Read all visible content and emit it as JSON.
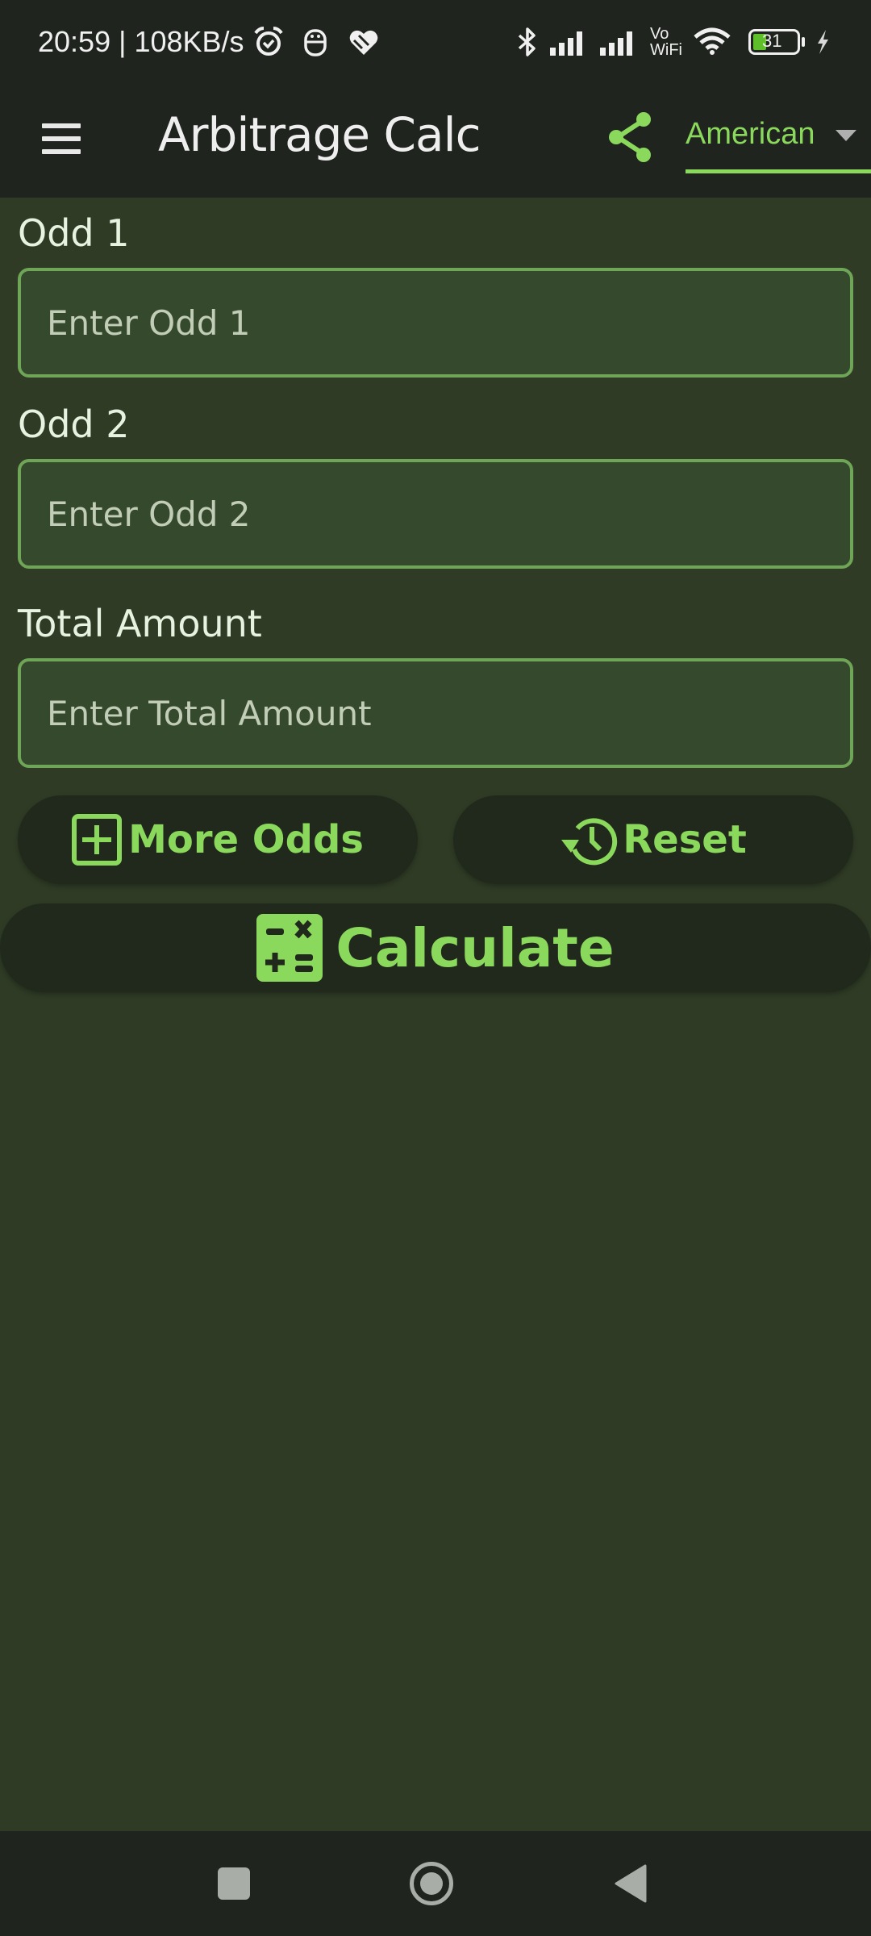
{
  "status_bar": {
    "time": "20:59",
    "separator": "|",
    "net_speed": "108KB/s",
    "left_icons": [
      "alarm-icon",
      "app-notification-icon",
      "heart-app-icon"
    ],
    "right_icons": [
      "bluetooth-icon",
      "signal-1-icon",
      "signal-2-icon",
      "vowifi-icon",
      "wifi-icon",
      "battery-icon",
      "charging-icon"
    ],
    "vowifi_top": "Vo",
    "vowifi_bottom": "WiFi",
    "battery_level": "31",
    "battery_fill_color": "#5fbf2a"
  },
  "app_bar": {
    "menu_icon": "hamburger-menu-icon",
    "title": "Arbitrage Calc",
    "share_icon": "share-icon",
    "odds_format": {
      "selected": "American"
    }
  },
  "form": {
    "fields": [
      {
        "label": "Odd 1",
        "placeholder": "Enter Odd 1",
        "value": ""
      },
      {
        "label": "Odd 2",
        "placeholder": "Enter Odd 2",
        "value": ""
      },
      {
        "label": "Total Amount",
        "placeholder": "Enter Total Amount",
        "value": ""
      }
    ]
  },
  "buttons": {
    "more_odds": {
      "label": "More Odds",
      "icon": "plus-square-icon"
    },
    "reset": {
      "label": "Reset",
      "icon": "history-icon"
    },
    "calculate": {
      "label": "Calculate",
      "icon": "calculator-icon"
    }
  },
  "nav_bar": {
    "items": [
      "recents-square-icon",
      "home-circle-icon",
      "back-triangle-icon"
    ]
  },
  "colors": {
    "accent": "#8ad85c",
    "background": "#2f3b25",
    "bar_background": "#1f241e",
    "field_border": "#6fa557",
    "field_fill": "#354a2c",
    "button_fill": "#21291c"
  }
}
